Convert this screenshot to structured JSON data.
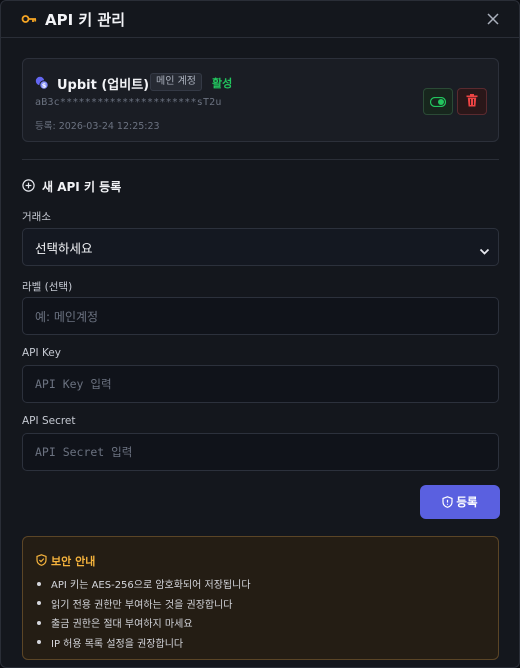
{
  "header": {
    "title": "API 키 관리"
  },
  "account": {
    "name": "Upbit (업비트)",
    "badge": "메인 계정",
    "status": "활성",
    "masked_key": "aB3c**********************sT2u",
    "registered": "등록: 2026-03-24 12:25:23"
  },
  "form": {
    "section_title": "새 API 키 등록",
    "exchange_label": "거래소",
    "exchange_value": "선택하세요",
    "label_label": "라벨 (선택)",
    "label_placeholder": "예: 메인계정",
    "key_label": "API Key",
    "key_placeholder": "API Key 입력",
    "secret_label": "API Secret",
    "secret_placeholder": "API Secret 입력",
    "submit_label": "등록"
  },
  "notice": {
    "title": "보안 안내",
    "items": [
      "API 키는 AES-256으로 암호화되어 저장됩니다",
      "읽기 전용 권한만 부여하는 것을 권장합니다",
      "출금 권한은 절대 부여하지 마세요",
      "IP 허용 목록 설정을 권장합니다"
    ]
  },
  "colors": {
    "accent": "#5a60e0",
    "active": "#22c55e",
    "danger": "#ef4444",
    "warning": "#f5b33d",
    "key_icon": "#f5a524"
  },
  "icons": [
    "key-icon",
    "close-icon",
    "coin-icon",
    "toggle-icon",
    "trash-icon",
    "plus-circle-icon",
    "chevron-down-icon",
    "shield-icon"
  ]
}
